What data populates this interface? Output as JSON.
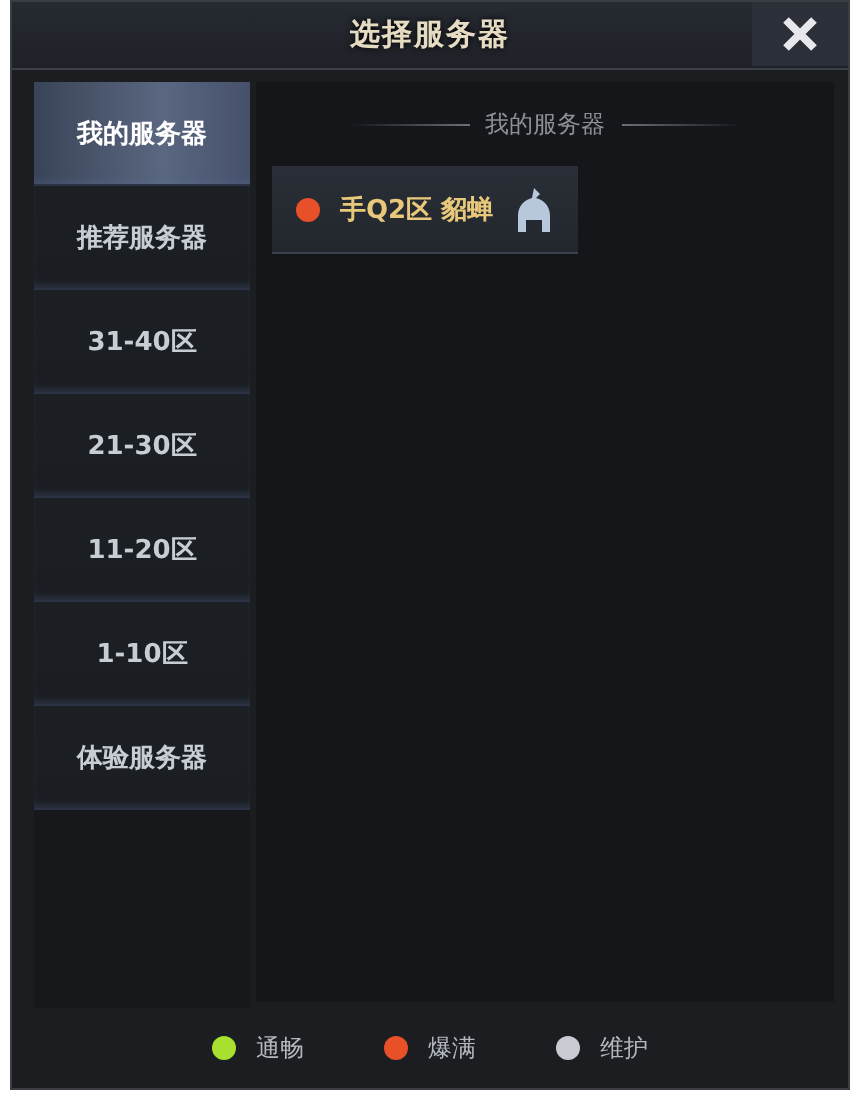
{
  "window": {
    "title": "选择服务器"
  },
  "sidebar": {
    "items": [
      {
        "label": "我的服务器",
        "selected": true
      },
      {
        "label": "推荐服务器",
        "selected": false
      },
      {
        "label": "31-40区",
        "selected": false
      },
      {
        "label": "21-30区",
        "selected": false
      },
      {
        "label": "11-20区",
        "selected": false
      },
      {
        "label": "1-10区",
        "selected": false
      },
      {
        "label": "体验服务器",
        "selected": false
      }
    ]
  },
  "content": {
    "heading": "我的服务器",
    "servers": [
      {
        "name": "手Q2区 貂蝉",
        "color": "#e8502a"
      }
    ]
  },
  "legend": [
    {
      "label": "通畅",
      "color": "#a8e030"
    },
    {
      "label": "爆满",
      "color": "#e8502a"
    },
    {
      "label": "维护",
      "color": "#c8ccd2"
    }
  ]
}
